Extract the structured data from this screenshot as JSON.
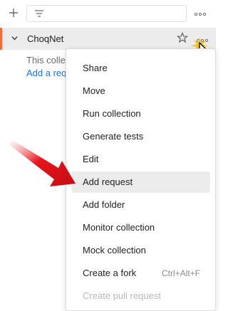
{
  "toolbar": {
    "add_icon": "plus-icon",
    "filter_icon": "filter-icon",
    "more_label": "ooo"
  },
  "collection": {
    "name": "ChoqNet",
    "expanded": true,
    "empty_text": "This colle",
    "empty_link": "Add a requ",
    "more_label": "ooo"
  },
  "menu": {
    "items": [
      {
        "label": "Share"
      },
      {
        "label": "Move"
      },
      {
        "label": "Run collection"
      },
      {
        "label": "Generate tests"
      },
      {
        "label": "Edit"
      },
      {
        "label": "Add request",
        "highlighted": true
      },
      {
        "label": "Add folder"
      },
      {
        "label": "Monitor collection"
      },
      {
        "label": "Mock collection"
      },
      {
        "label": "Create a fork",
        "shortcut": "Ctrl+Alt+F"
      },
      {
        "label": "Create pull request",
        "disabled": true
      }
    ]
  },
  "colors": {
    "accent": "#f26b3a",
    "link": "#1a73e8",
    "highlight": "#ececec",
    "annotation_arrow": "#e8141c"
  }
}
